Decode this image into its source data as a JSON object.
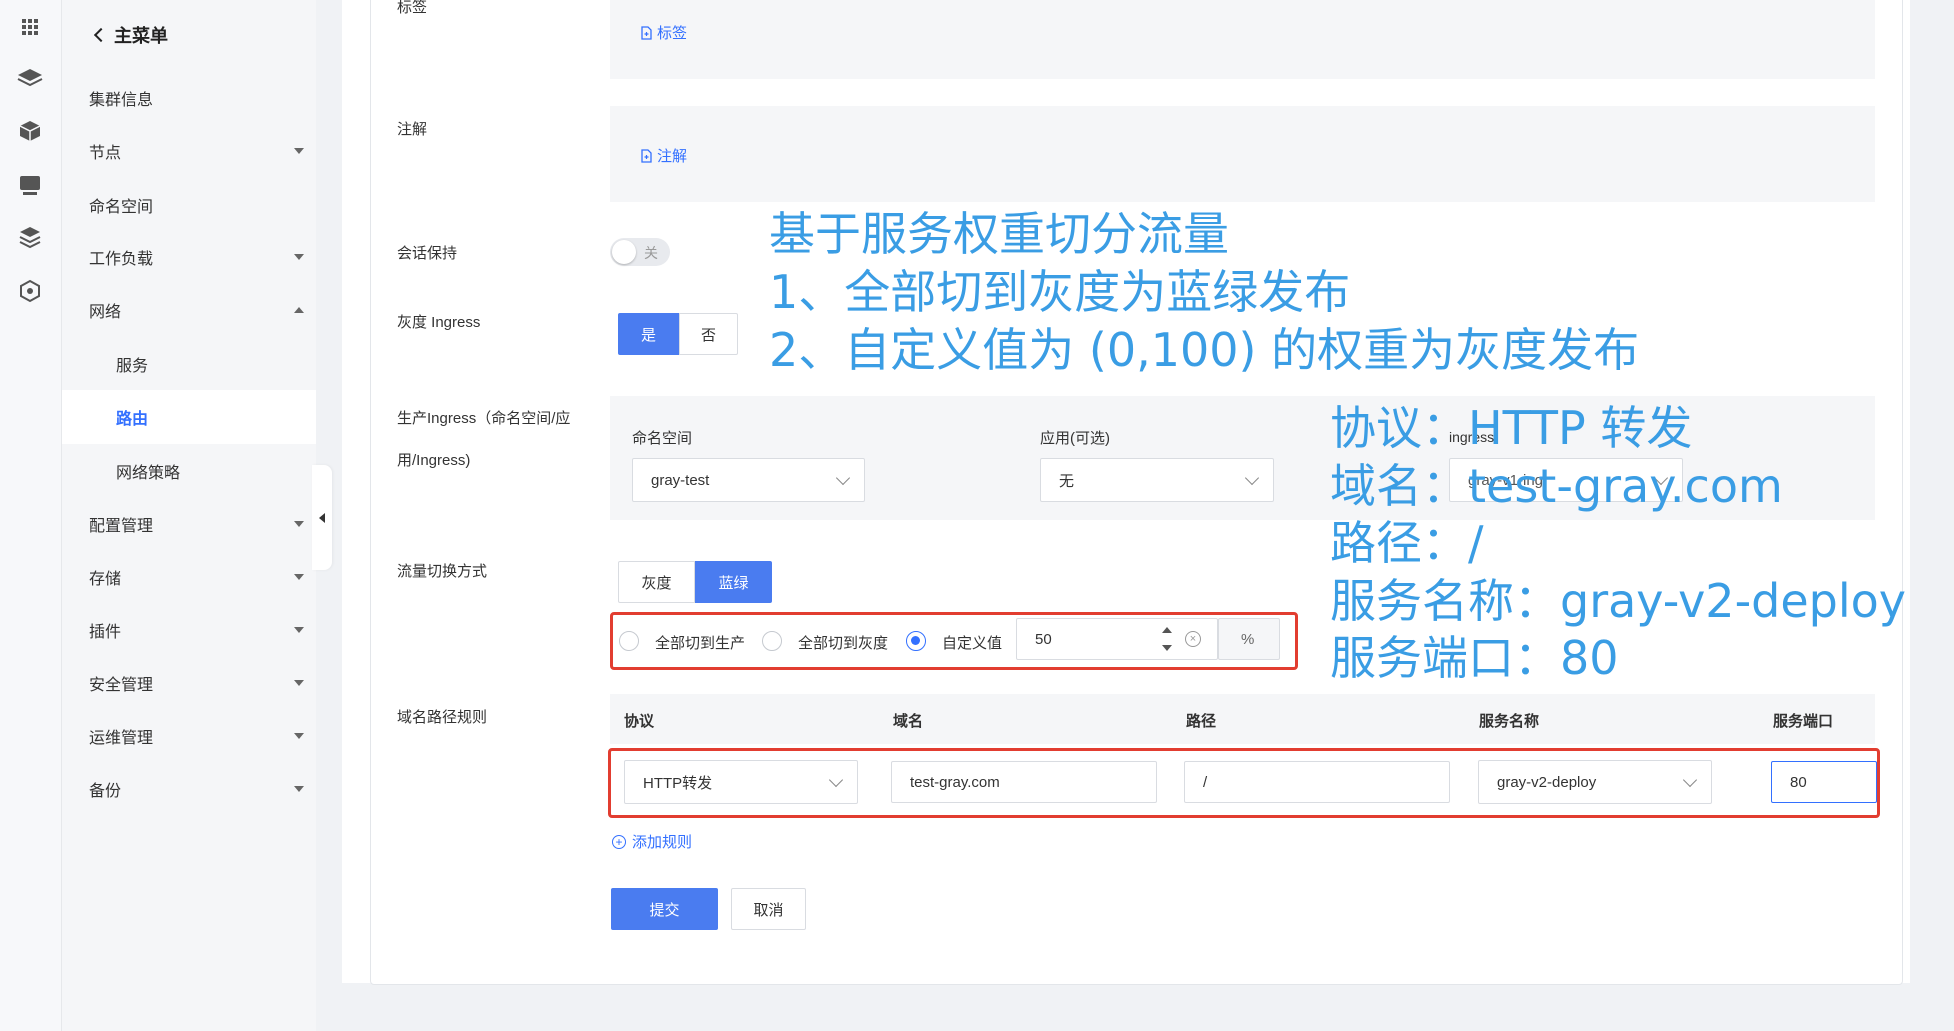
{
  "sidebar": {
    "back_label": "主菜单",
    "items": [
      {
        "label": "集群信息"
      },
      {
        "label": "节点"
      },
      {
        "label": "命名空间"
      },
      {
        "label": "工作负载"
      },
      {
        "label": "网络"
      },
      {
        "label": "服务"
      },
      {
        "label": "路由"
      },
      {
        "label": "网络策略"
      },
      {
        "label": "配置管理"
      },
      {
        "label": "存储"
      },
      {
        "label": "插件"
      },
      {
        "label": "安全管理"
      },
      {
        "label": "运维管理"
      },
      {
        "label": "备份"
      }
    ]
  },
  "form": {
    "labels_label": "标签",
    "labels_link": "标签",
    "annotations_label": "注解",
    "annotations_link": "注解",
    "session_label": "会话保持",
    "session_toggle": "关",
    "gray_ingress_label": "灰度 Ingress",
    "gray_yes": "是",
    "gray_no": "否",
    "prod_ingress_label_1": "生产Ingress（命名空间/应",
    "prod_ingress_label_2": "用/Ingress)",
    "ns_head": "命名空间",
    "ns_value": "gray-test",
    "app_head": "应用(可选)",
    "app_value": "无",
    "ingress_head": "ingress",
    "ingress_value": "gray-v1-ing",
    "switch_label": "流量切换方式",
    "switch_gray": "灰度",
    "switch_bluegreen": "蓝绿",
    "radio_prod": "全部切到生产",
    "radio_gray": "全部切到灰度",
    "radio_custom": "自定义值",
    "custom_value": "50",
    "percent": "%",
    "rules_label": "域名路径规则",
    "col_protocol": "协议",
    "col_domain": "域名",
    "col_path": "路径",
    "col_service": "服务名称",
    "col_port": "服务端口",
    "row_protocol": "HTTP转发",
    "row_domain": "test-gray.com",
    "row_path": "/",
    "row_service": "gray-v2-deploy",
    "row_port": "80",
    "add_rule": "添加规则",
    "submit": "提交",
    "cancel": "取消"
  },
  "annotations": {
    "line1": "基于服务权重切分流量",
    "line2": "1、全部切到灰度为蓝绿发布",
    "line3": "2、自定义值为 (0,100) 的权重为灰度发布",
    "r1": "协议：HTTP 转发",
    "r2": "域名：test-gray.com",
    "r3": "路径：/",
    "r4": "服务名称：gray-v2-deploy",
    "r5": "服务端口：80"
  },
  "colors": {
    "accent": "#3370ff",
    "button_blue": "#4a7cf0",
    "highlight_red": "#e23d30",
    "annotation_blue": "#3a9de4"
  }
}
